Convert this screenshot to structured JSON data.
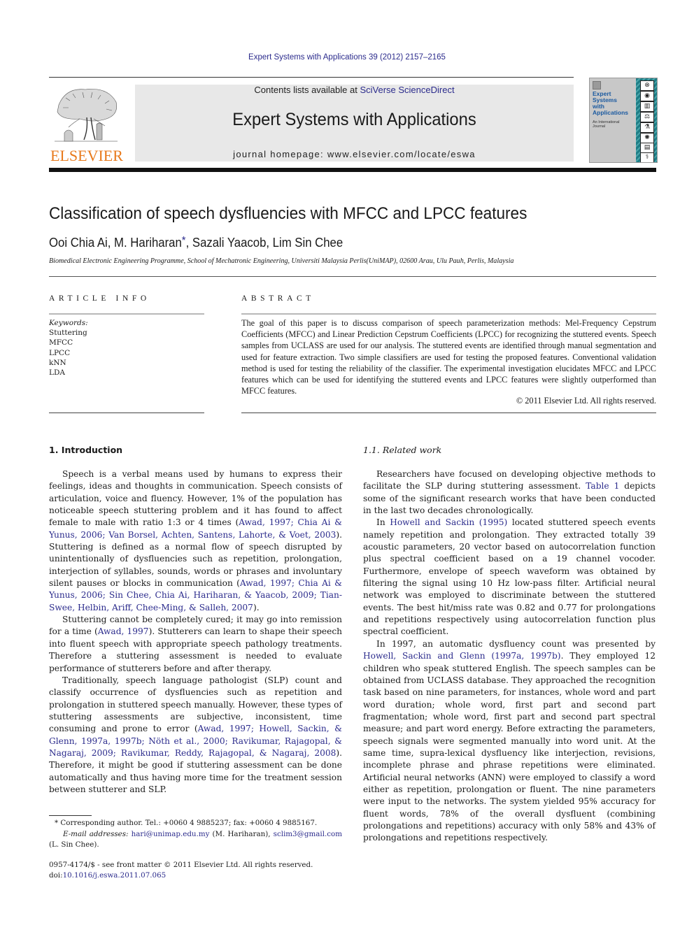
{
  "journal_citation": "Expert Systems with Applications 39 (2012) 2157–2165",
  "masthead": {
    "publisher_logo_text": "ELSEVIER",
    "contents_prefix": "Contents lists available at ",
    "contents_link": "SciVerse ScienceDirect",
    "journal_title": "Expert Systems with Applications",
    "homepage": "journal homepage: www.elsevier.com/locate/eswa",
    "cover_title_lines": [
      "Expert",
      "Systems",
      "with",
      "Applications"
    ],
    "cover_subtitle_lines": [
      "An International",
      "Journal"
    ],
    "cover_icons": [
      "⊗",
      "◉",
      "▥",
      "⚖",
      "⚗",
      "✺",
      "▤",
      "⚕"
    ]
  },
  "article": {
    "title": "Classification of speech dysfluencies with MFCC and LPCC features",
    "authors_before_star": "Ooi Chia Ai, M. Hariharan",
    "corresponding_mark": "*",
    "authors_after_star": ", Sazali Yaacob, Lim Sin Chee",
    "affiliation": "Biomedical Electronic Engineering Programme, School of Mechatronic Engineering, Universiti Malaysia Perlis(UniMAP), 02600 Arau, Ulu Pauh, Perlis, Malaysia"
  },
  "article_info": {
    "heading": "ARTICLE INFO",
    "keywords_label": "Keywords:",
    "keywords": [
      "Stuttering",
      "MFCC",
      "LPCC",
      "kNN",
      "LDA"
    ]
  },
  "abstract": {
    "heading": "ABSTRACT",
    "text": "The goal of this paper is to discuss comparison of speech parameterization methods: Mel-Frequency Cepstrum Coefficients (MFCC) and Linear Prediction Cepstrum Coefficients (LPCC) for recognizing the stuttered events. Speech samples from UCLASS are used for our analysis. The stuttered events are identified through manual segmentation and used for feature extraction. Two simple classifiers are used for testing the proposed features. Conventional validation method is used for testing the reliability of the classifier. The experimental investigation elucidates MFCC and LPCC features which can be used for identifying the stuttered events and LPCC features were slightly outperformed than MFCC features.",
    "copyright": "© 2011 Elsevier Ltd. All rights reserved."
  },
  "introduction": {
    "heading": "1. Introduction",
    "p1": [
      {
        "t": "Speech is a verbal means used by humans to express their feelings, ideas and thoughts in communication. Speech consists of articulation, voice and fluency. However, 1% of the population has noticeable speech stuttering problem and it has found to affect female to male with ratio 1:3 or 4 times (",
        "link": false
      },
      {
        "t": "Awad, 1997; Chia Ai & Yunus, 2006; Van Borsel, Achten, Santens, Lahorte, & Voet, 2003",
        "link": true
      },
      {
        "t": "). Stuttering is defined as a normal flow of speech disrupted by unintentionally of dysfluencies such as repetition, prolongation, interjection of syllables, sounds, words or phrases and involuntary silent pauses or blocks in communication (",
        "link": false
      },
      {
        "t": "Awad, 1997; Chia Ai & Yunus, 2006; Sin Chee, Chia Ai, Hariharan, & Yaacob, 2009; Tian-Swee, Helbin, Ariff, Chee-Ming, & Salleh, 2007",
        "link": true
      },
      {
        "t": ").",
        "link": false
      }
    ],
    "p2": [
      {
        "t": "Stuttering cannot be completely cured; it may go into remission for a time (",
        "link": false
      },
      {
        "t": "Awad, 1997",
        "link": true
      },
      {
        "t": "). Stutterers can learn to shape their speech into fluent speech with appropriate speech pathology treatments. Therefore a stuttering assessment is needed to evaluate performance of stutterers before and after therapy.",
        "link": false
      }
    ],
    "p3": [
      {
        "t": "Traditionally, speech language pathologist (SLP) count and classify occurrence of dysfluencies such as repetition and prolongation in stuttered speech manually. However, these types of stuttering assessments are subjective, inconsistent, time consuming and prone to error (",
        "link": false
      },
      {
        "t": "Awad, 1997; Howell, Sackin, & Glenn, 1997a, 1997b; Nöth et al., 2000; Ravikumar, Rajagopal, & Nagaraj, 2009; Ravikumar, Reddy, Rajagopal, & Nagaraj, 2008",
        "link": true
      },
      {
        "t": "). Therefore, it might be good if stuttering assessment can be done automatically and thus having more time for the treatment session between stutterer and SLP.",
        "link": false
      }
    ]
  },
  "related_work": {
    "heading": "1.1. Related work",
    "p1": [
      {
        "t": "Researchers have focused on developing objective methods to facilitate the SLP during stuttering assessment. ",
        "link": false
      },
      {
        "t": "Table 1",
        "link": true
      },
      {
        "t": " depicts some of the significant research works that have been conducted in the last two decades chronologically.",
        "link": false
      }
    ],
    "p2": [
      {
        "t": "In ",
        "link": false
      },
      {
        "t": "Howell and Sackin (1995)",
        "link": true
      },
      {
        "t": " located stuttered speech events namely repetition and prolongation. They extracted totally 39 acoustic parameters, 20 vector based on autocorrelation function plus spectral coefficient based on a 19 channel vocoder. Furthermore, envelope of speech waveform was obtained by filtering the signal using 10 Hz low-pass filter. Artificial neural network was employed to discriminate between the stuttered events. The best hit/miss rate was 0.82 and 0.77 for prolongations and repetitions respectively using autocorrelation function plus spectral coefficient.",
        "link": false
      }
    ],
    "p3": [
      {
        "t": "In 1997, an automatic dysfluency count was presented by ",
        "link": false
      },
      {
        "t": "Howell, Sackin and Glenn (1997a, 1997b)",
        "link": true
      },
      {
        "t": ". They employed 12 children who speak stuttered English. The speech samples can be obtained from UCLASS database. They approached the recognition task based on nine parameters, for instances, whole word and part word duration; whole word, first part and second part fragmentation; whole word, first part and second part spectral measure; and part word energy. Before extracting the parameters, speech signals were segmented manually into word unit. At the same time, supra-lexical dysfluency like interjection, revisions, incomplete phrase and phrase repetitions were eliminated. Artificial neural networks (ANN) were employed to classify a word either as repetition, prolongation or fluent. The nine parameters were input to the networks. The system yielded 95% accuracy for fluent words, 78% of the overall dysfluent (combining prolongations and repetitions) accuracy with only 58% and 43% of prolongations and repetitions respectively.",
        "link": false
      }
    ]
  },
  "footnotes": {
    "corresponding": "*  Corresponding author. Tel.: +0060 4 9885237; fax: +0060 4 9885167.",
    "email_label": "E-mail addresses:",
    "email1": "hari@unimap.edu.my",
    "email1_name": " (M. Hariharan), ",
    "email2": "sclim3@gmail.com",
    "email2_name": " (L. Sin Chee).",
    "front_matter": "0957-4174/$ - see front matter © 2011 Elsevier Ltd. All rights reserved.",
    "doi_prefix": "doi:",
    "doi": "10.1016/j.eswa.2011.07.065"
  },
  "colors": {
    "link": "#2b2b8c",
    "elsevier_orange": "#e87a1c",
    "masthead_gray": "#e8e8e8",
    "cover_teal": "#1e7e86"
  }
}
